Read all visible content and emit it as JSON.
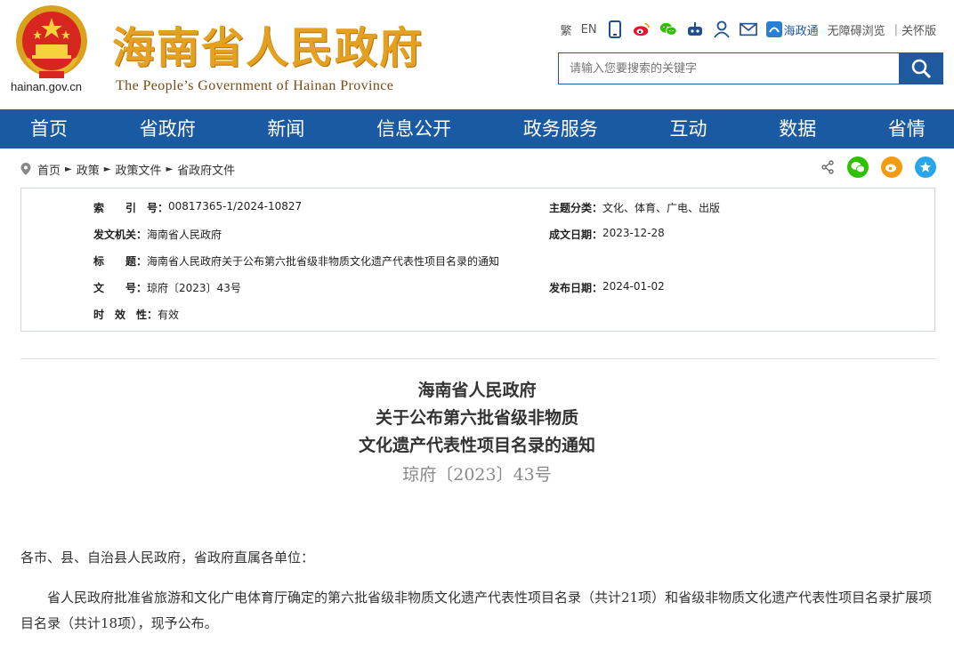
{
  "header": {
    "domain": "hainan.gov.cn",
    "title": "海南省人民政府",
    "subtitle": "The People’s Government  of Hainan Province",
    "topbar": {
      "traditional": "繁",
      "english": "EN",
      "app_label": "海政通",
      "accessibility": "无障碍浏览",
      "care_mode": "关怀版",
      "separator": "|"
    },
    "search": {
      "placeholder": "请输入您要搜索的关键字"
    }
  },
  "nav": {
    "items": [
      "首页",
      "省政府",
      "新闻",
      "信息公开",
      "政务服务",
      "互动",
      "数据",
      "省情"
    ]
  },
  "breadcrumb": [
    "首页",
    "政策",
    "政策文件",
    "省政府文件"
  ],
  "meta": {
    "index_label": "索　　引　号：",
    "index_value": "00817365-1/2024-10827",
    "category_label": "主题分类：",
    "category_value": "文化、体育、广电、出版",
    "issuer_label": "发文机关：",
    "issuer_value": "海南省人民政府",
    "date_label": "成文日期：",
    "date_value": "2023-12-28",
    "subject_label": "标　　题：",
    "subject_value": "海南省人民政府关于公布第六批省级非物质文化遗产代表性项目名录的通知",
    "docno_label": "文　　号：",
    "docno_value": "琼府〔2023〕43号",
    "publish_label": "发布日期：",
    "publish_value": "2024-01-02",
    "validity_label": "时　效　性：",
    "validity_value": "有效"
  },
  "document": {
    "title_line1": "海南省人民政府",
    "title_line2": "关于公布第六批省级非物质",
    "title_line3": "文化遗产代表性项目名录的通知",
    "doc_number": "琼府〔2023〕43号",
    "salutation": "各市、县、自治县人民政府，省政府直属各单位：",
    "body": "　　省人民政府批准省旅游和文化广电体育厅确定的第六批省级非物质文化遗产代表性项目名录（共计21项）和省级非物质文化遗产代表性项目名录扩展项目名录（共计18项），现予公布。"
  },
  "colors": {
    "nav_blue": "#1a5aa3",
    "title_gold": "#e4a01f",
    "wechat_green": "#2dc100",
    "weibo_orange": "#f39c12",
    "favorite_blue": "#2aa6e8"
  }
}
